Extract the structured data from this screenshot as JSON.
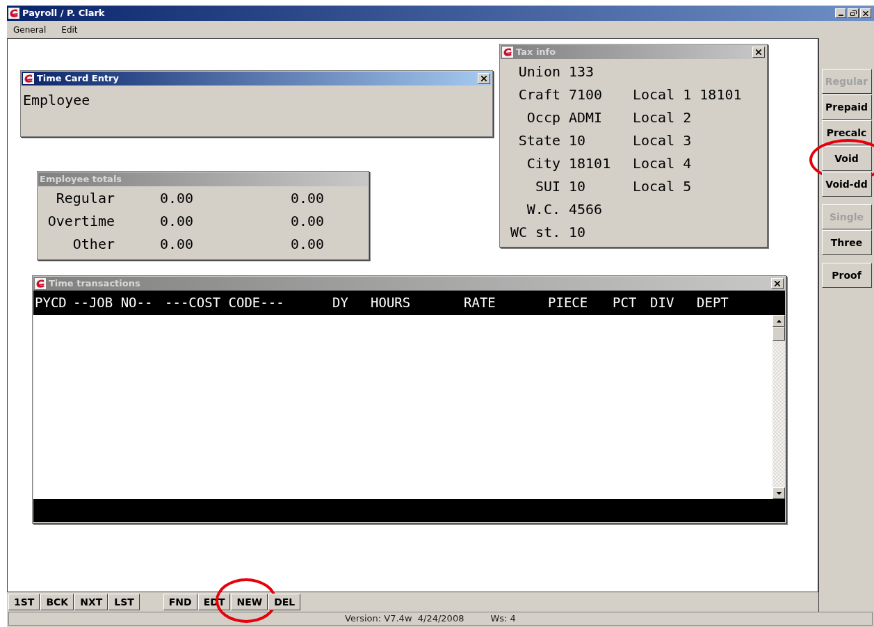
{
  "window": {
    "title": "Payroll / P. Clark"
  },
  "menu": [
    {
      "label": "General"
    },
    {
      "label": "Edit"
    }
  ],
  "time_card_entry": {
    "title": "Time Card Entry",
    "field_label": "Employee"
  },
  "tax_info": {
    "title": "Tax info",
    "left": [
      {
        "label": "Union",
        "value": "133"
      },
      {
        "label": "Craft",
        "value": "7100"
      },
      {
        "label": "Occp",
        "value": "ADMI"
      },
      {
        "label": "State",
        "value": "10"
      },
      {
        "label": "City",
        "value": "18101"
      },
      {
        "label": "SUI",
        "value": "10"
      },
      {
        "label": "W.C.",
        "value": "4566"
      },
      {
        "label": "WC st.",
        "value": "10"
      }
    ],
    "locals": [
      {
        "label": "Local 1",
        "value": "18101"
      },
      {
        "label": "Local 2"
      },
      {
        "label": "Local 3"
      },
      {
        "label": "Local 4"
      },
      {
        "label": "Local 5"
      }
    ]
  },
  "employee_totals": {
    "title": "Employee totals",
    "rows": [
      {
        "label": "Regular",
        "value_1": "0.00",
        "value_2": "0.00"
      },
      {
        "label": "Overtime",
        "value_1": "0.00",
        "value_2": "0.00"
      },
      {
        "label": "Other",
        "value_1": "0.00",
        "value_2": "0.00"
      }
    ]
  },
  "time_transactions": {
    "title": "Time transactions",
    "columns": [
      "PYCD",
      "--JOB NO--",
      "---COST CODE---",
      "DY",
      "HOURS",
      "RATE",
      "PIECE",
      "PCT",
      "DIV",
      "DEPT"
    ]
  },
  "side_button_groups": [
    [
      {
        "label": "Regular",
        "disabled": true,
        "circled": false
      },
      {
        "label": "Prepaid",
        "disabled": false,
        "circled": false
      },
      {
        "label": "Precalc",
        "disabled": false,
        "circled": false
      },
      {
        "label": "Void",
        "disabled": false,
        "circled": true
      },
      {
        "label": "Void-dd",
        "disabled": false,
        "circled": false
      }
    ],
    [
      {
        "label": "Single",
        "disabled": true,
        "circled": false
      },
      {
        "label": "Three",
        "disabled": false,
        "circled": false
      }
    ],
    [
      {
        "label": "Proof",
        "disabled": false,
        "circled": false
      }
    ]
  ],
  "toolbar_groups": [
    [
      {
        "label": "1ST",
        "circled": false
      },
      {
        "label": "BCK",
        "circled": false
      },
      {
        "label": "NXT",
        "circled": false
      },
      {
        "label": "LST",
        "circled": false
      }
    ],
    [
      {
        "label": "FND",
        "circled": false
      },
      {
        "label": "EDT",
        "circled": false
      },
      {
        "label": "NEW",
        "circled": true
      },
      {
        "label": "DEL",
        "circled": false
      }
    ]
  ],
  "status_bar": {
    "version": "Version: V7.4w  4/24/2008",
    "workstation": "Ws: 4"
  }
}
